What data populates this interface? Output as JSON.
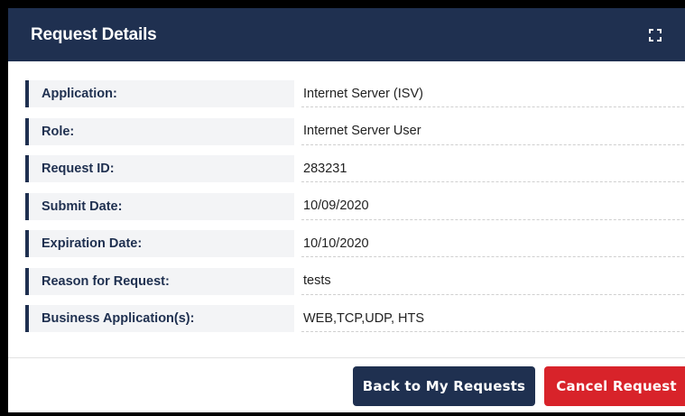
{
  "header": {
    "title": "Request Details",
    "expand_icon": "expand-icon"
  },
  "details": [
    {
      "label": "Application:",
      "value": "Internet Server (ISV)"
    },
    {
      "label": "Role:",
      "value": "Internet Server User"
    },
    {
      "label": "Request ID:",
      "value": "283231"
    },
    {
      "label": "Submit Date:",
      "value": "10/09/2020"
    },
    {
      "label": "Expiration Date:",
      "value": "10/10/2020"
    },
    {
      "label": "Reason for Request:",
      "value": "tests"
    },
    {
      "label": "Business Application(s):",
      "value": "WEB,TCP,UDP, HTS"
    }
  ],
  "footer": {
    "back_label": "Back to My Requests",
    "cancel_label": "Cancel Request"
  },
  "colors": {
    "header_bg": "#1f3050",
    "cancel_bg": "#d8232a"
  }
}
